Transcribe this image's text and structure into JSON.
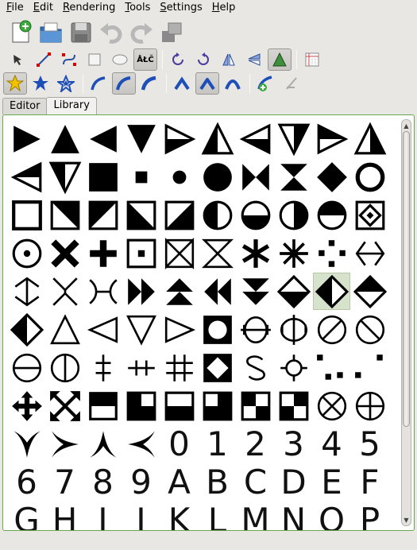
{
  "menu": [
    {
      "pre": "",
      "acc": "F",
      "post": "ile"
    },
    {
      "pre": "",
      "acc": "E",
      "post": "dit"
    },
    {
      "pre": "",
      "acc": "R",
      "post": "endering"
    },
    {
      "pre": "",
      "acc": "T",
      "post": "ools"
    },
    {
      "pre": "",
      "acc": "S",
      "post": "ettings"
    },
    {
      "pre": "",
      "acc": "H",
      "post": "elp"
    }
  ],
  "toolbar_main": [
    "new-document-icon",
    "open-folder-icon",
    "save-icon",
    "undo-icon",
    "redo-icon",
    "export-icon"
  ],
  "tool_label": "ÅŁČ",
  "tabs": {
    "editor": "Editor",
    "library": "Library"
  },
  "colors": {
    "accent_green": "#6aa84f",
    "selection": "#d7e2cc",
    "blue": "#1e4fb8"
  },
  "library": {
    "glyph_rows": [
      [
        "0",
        "1",
        "2",
        "3",
        "4",
        "5"
      ],
      [
        "6",
        "7",
        "8",
        "9",
        "A",
        "B",
        "C",
        "D",
        "E",
        "F"
      ],
      [
        "G",
        "H",
        "I",
        "J",
        "K",
        "L",
        "M",
        "N",
        "O",
        "P"
      ]
    ],
    "selected_symbol": "half-filled-diamond"
  }
}
